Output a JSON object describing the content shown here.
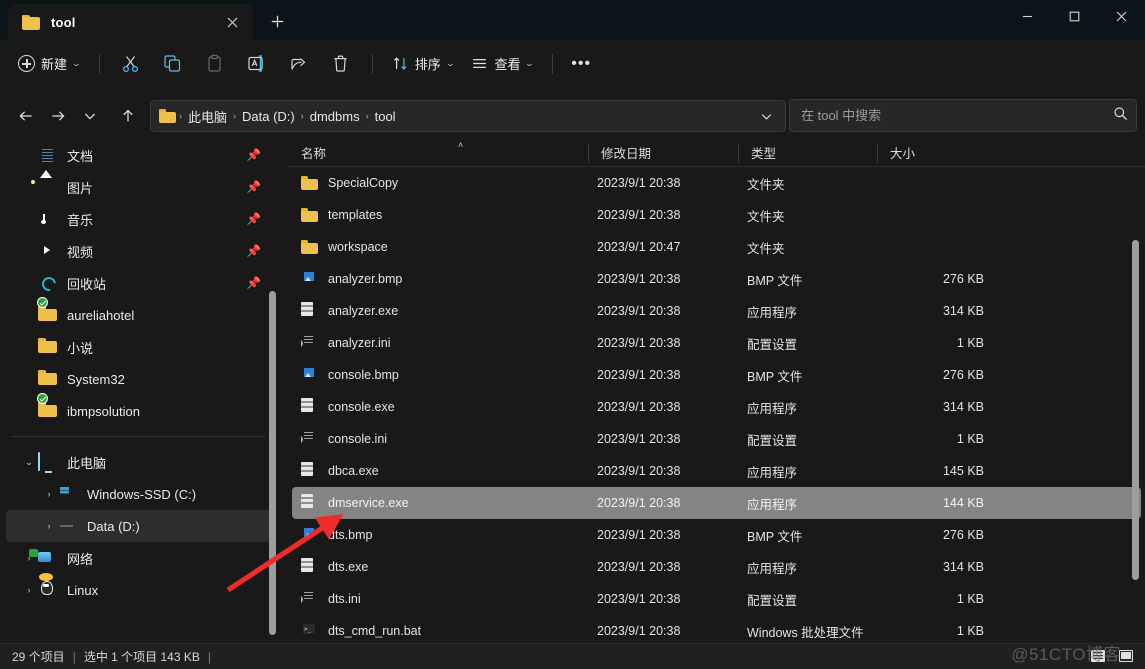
{
  "window": {
    "tab_title": "tool",
    "tab_close_icon": "close-icon",
    "new_tab_icon": "plus-icon",
    "minimize_icon": "minimize-icon",
    "maximize_icon": "maximize-icon",
    "close_icon": "close-icon"
  },
  "toolbar": {
    "new_label": "新建",
    "cut_icon": "scissors-icon",
    "copy_icon": "copy-icon",
    "paste_icon": "paste-icon",
    "rename_icon": "rename-icon",
    "share_icon": "share-icon",
    "delete_icon": "trash-icon",
    "sort_label": "排序",
    "sort_icon": "sort-arrows-icon",
    "view_label": "查看",
    "view_icon": "list-lines-icon",
    "more_label": "•••"
  },
  "address": {
    "back_icon": "arrow-left-icon",
    "forward_icon": "arrow-right-icon",
    "recent_icon": "chevron-down-icon",
    "up_icon": "arrow-up-icon",
    "folder_icon": "folder-icon",
    "crumbs": [
      "此电脑",
      "Data (D:)",
      "dmdbms",
      "tool"
    ],
    "separator": "›",
    "dropdown_icon": "chevron-down-icon",
    "refresh_icon": "refresh-icon"
  },
  "search": {
    "placeholder": "在 tool 中搜索",
    "value": "",
    "icon": "search-icon"
  },
  "sidebar": {
    "quick_items": [
      {
        "label": "文档",
        "icon": "documents-icon",
        "pinned": true
      },
      {
        "label": "图片",
        "icon": "pictures-icon",
        "pinned": true
      },
      {
        "label": "音乐",
        "icon": "music-icon",
        "pinned": true
      },
      {
        "label": "视频",
        "icon": "videos-icon",
        "pinned": true
      },
      {
        "label": "回收站",
        "icon": "recycle-bin-icon",
        "pinned": true
      },
      {
        "label": "aureliahotel",
        "icon": "folder-synced-icon",
        "pinned": false
      },
      {
        "label": "小说",
        "icon": "folder-icon",
        "pinned": false
      },
      {
        "label": "System32",
        "icon": "folder-icon",
        "pinned": false
      },
      {
        "label": "ibmpsolution",
        "icon": "folder-synced-icon",
        "pinned": false
      }
    ],
    "tree_items": [
      {
        "label": "此电脑",
        "icon": "this-pc-icon",
        "expanded": true,
        "indent": 0,
        "selected": false
      },
      {
        "label": "Windows-SSD (C:)",
        "icon": "drive-system-icon",
        "expanded": false,
        "indent": 1,
        "selected": false
      },
      {
        "label": "Data (D:)",
        "icon": "drive-icon",
        "expanded": false,
        "indent": 1,
        "selected": true
      },
      {
        "label": "网络",
        "icon": "network-icon",
        "expanded": false,
        "indent": 0,
        "selected": false
      },
      {
        "label": "Linux",
        "icon": "linux-icon",
        "expanded": false,
        "indent": 0,
        "selected": false
      }
    ],
    "pin_icon": "pin-icon",
    "caret_collapsed": "›",
    "caret_expanded": "⌄"
  },
  "list": {
    "columns": [
      "名称",
      "修改日期",
      "类型",
      "大小"
    ],
    "sort_indicator": "˄",
    "rows": [
      {
        "name": "SpecialCopy",
        "date": "2023/9/1 20:38",
        "type": "文件夹",
        "size": "",
        "icon": "folder-icon",
        "selected": false
      },
      {
        "name": "templates",
        "date": "2023/9/1 20:38",
        "type": "文件夹",
        "size": "",
        "icon": "folder-icon",
        "selected": false
      },
      {
        "name": "workspace",
        "date": "2023/9/1 20:47",
        "type": "文件夹",
        "size": "",
        "icon": "folder-icon",
        "selected": false
      },
      {
        "name": "analyzer.bmp",
        "date": "2023/9/1 20:38",
        "type": "BMP 文件",
        "size": "276 KB",
        "icon": "bmp-file-icon",
        "selected": false
      },
      {
        "name": "analyzer.exe",
        "date": "2023/9/1 20:38",
        "type": "应用程序",
        "size": "314 KB",
        "icon": "exe-file-icon",
        "selected": false
      },
      {
        "name": "analyzer.ini",
        "date": "2023/9/1 20:38",
        "type": "配置设置",
        "size": "1 KB",
        "icon": "ini-file-icon",
        "selected": false
      },
      {
        "name": "console.bmp",
        "date": "2023/9/1 20:38",
        "type": "BMP 文件",
        "size": "276 KB",
        "icon": "bmp-file-icon",
        "selected": false
      },
      {
        "name": "console.exe",
        "date": "2023/9/1 20:38",
        "type": "应用程序",
        "size": "314 KB",
        "icon": "exe-file-icon",
        "selected": false
      },
      {
        "name": "console.ini",
        "date": "2023/9/1 20:38",
        "type": "配置设置",
        "size": "1 KB",
        "icon": "ini-file-icon",
        "selected": false
      },
      {
        "name": "dbca.exe",
        "date": "2023/9/1 20:38",
        "type": "应用程序",
        "size": "145 KB",
        "icon": "exe-file-icon",
        "selected": false
      },
      {
        "name": "dmservice.exe",
        "date": "2023/9/1 20:38",
        "type": "应用程序",
        "size": "144 KB",
        "icon": "exe-file-icon",
        "selected": true
      },
      {
        "name": "dts.bmp",
        "date": "2023/9/1 20:38",
        "type": "BMP 文件",
        "size": "276 KB",
        "icon": "bmp-file-icon",
        "selected": false
      },
      {
        "name": "dts.exe",
        "date": "2023/9/1 20:38",
        "type": "应用程序",
        "size": "314 KB",
        "icon": "exe-file-icon",
        "selected": false
      },
      {
        "name": "dts.ini",
        "date": "2023/9/1 20:38",
        "type": "配置设置",
        "size": "1 KB",
        "icon": "ini-file-icon",
        "selected": false
      },
      {
        "name": "dts_cmd_run.bat",
        "date": "2023/9/1 20:38",
        "type": "Windows 批处理文件",
        "size": "1 KB",
        "icon": "bat-file-icon",
        "selected": false
      }
    ]
  },
  "status": {
    "item_count": "29 个项目",
    "sep1": "|",
    "selection": "选中 1 个项目  143 KB",
    "sep2": "|",
    "details_view_icon": "details-view-icon",
    "tiles_view_icon": "large-icons-view-icon"
  },
  "annotation": {
    "watermark": "@51CTO博客",
    "arrow_color": "#ef2b2b"
  },
  "colors": {
    "window_bg": "#191919",
    "titlebar_bg": "#0b1418",
    "selection_bg": "#848484",
    "accent": "#4cc2ff"
  }
}
